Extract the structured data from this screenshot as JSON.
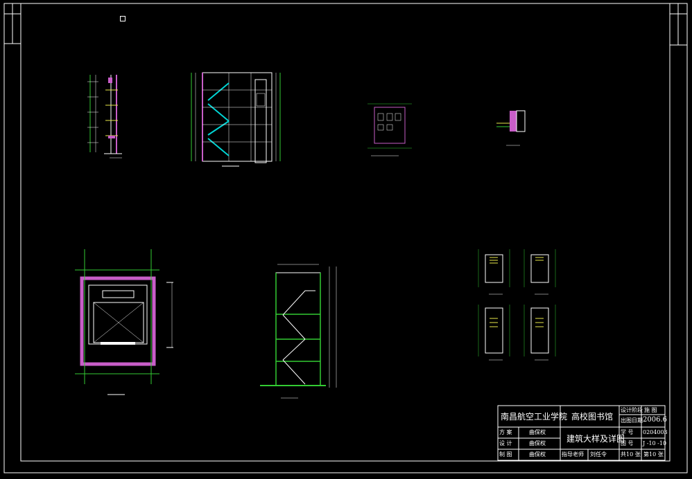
{
  "title_block": {
    "school": "南昌航空工业学院",
    "project": "高校图书馆",
    "drawing_title": "建筑大样及详图",
    "role_scheme": "方 案",
    "role_design": "设 计",
    "role_draw": "制 图",
    "name_scheme": "曲保权",
    "name_design": "曲保权",
    "name_draw": "曲保权",
    "tutor_label": "指导老师",
    "tutor_name": "刘任令",
    "stage_label": "设计阶段",
    "stage_value": "施 图",
    "date_label": "出图日期",
    "date_value": "2006.6",
    "number_label": "学 号",
    "number_value": "0204003",
    "sheet_label": "图 号",
    "sheet_value": "J -10 -10",
    "total_pages": "共10 张",
    "page_no": "第10 张"
  },
  "colors": {
    "background": "#000000",
    "frame": "#ffffff",
    "wall": "#c85ec8",
    "stair": "#00d5d5",
    "line_green": "#33cc33",
    "dim_white": "#ffffff",
    "yellow": "#e8e84a"
  }
}
